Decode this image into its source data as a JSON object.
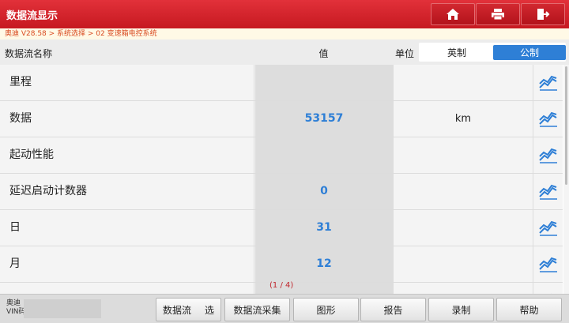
{
  "app": {
    "title": "数据流显示"
  },
  "toolbar": {
    "home_icon": "home-icon",
    "print_icon": "print-icon",
    "exit_icon": "exit-icon"
  },
  "breadcrumb": "奥迪 V28.58 > 系统选择 > 02 变速箱电控系统",
  "table": {
    "col_name": "数据流名称",
    "col_value": "值",
    "col_unit": "单位",
    "unit_options": [
      "英制",
      "公制"
    ],
    "unit_selected": "公制",
    "rows": [
      {
        "name": "里程",
        "value": "",
        "unit": ""
      },
      {
        "name": "数据",
        "value": "53157",
        "unit": "km"
      },
      {
        "name": "起动性能",
        "value": "",
        "unit": ""
      },
      {
        "name": "延迟启动计数器",
        "value": "0",
        "unit": ""
      },
      {
        "name": "日",
        "value": "31",
        "unit": ""
      },
      {
        "name": "月",
        "value": "12",
        "unit": ""
      },
      {
        "name": "",
        "value": "",
        "unit": ""
      }
    ]
  },
  "pager": "(1 / 4)",
  "footer": {
    "vehicle_line1": "奥迪",
    "vehicle_line2": "VIN码",
    "buttons": [
      "数据流",
      "选",
      "数据流采集",
      "图形",
      "报告",
      "录制",
      "帮助"
    ]
  },
  "colors": {
    "title_bar": "#d42a30",
    "value_text": "#2e7fd6",
    "toggle_active": "#2e7fd6"
  }
}
